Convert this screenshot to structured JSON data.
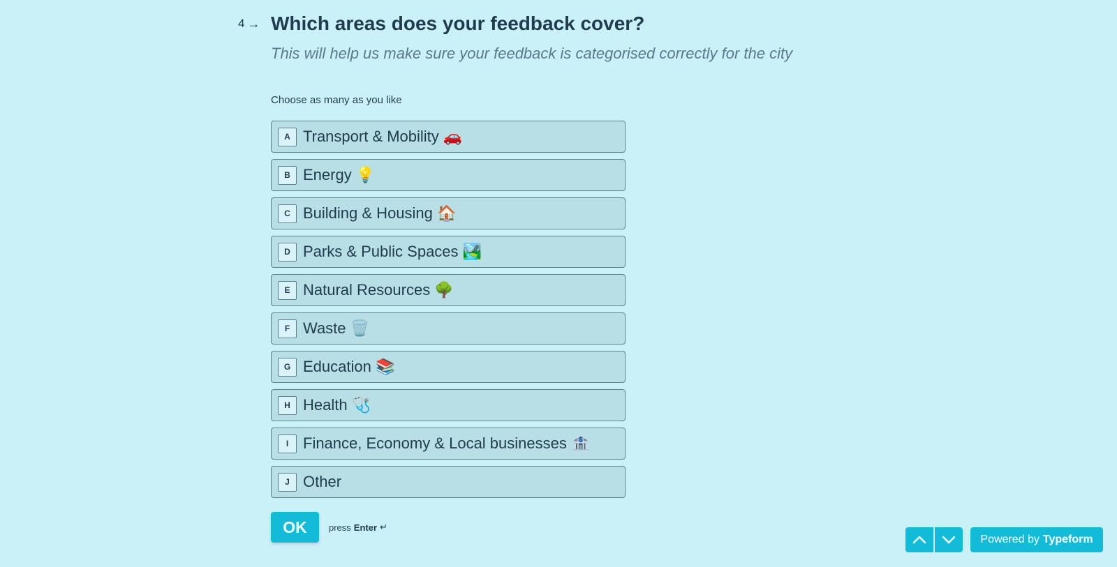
{
  "question": {
    "number": "4",
    "title": "Which areas does your feedback cover?",
    "subtitle": "This will help us make sure your feedback is categorised correctly for the city",
    "hint": "Choose as many as you like"
  },
  "options": [
    {
      "key": "A",
      "label": "Transport & Mobility 🚗"
    },
    {
      "key": "B",
      "label": "Energy 💡"
    },
    {
      "key": "C",
      "label": "Building & Housing 🏠"
    },
    {
      "key": "D",
      "label": "Parks & Public Spaces 🏞️"
    },
    {
      "key": "E",
      "label": "Natural Resources 🌳"
    },
    {
      "key": "F",
      "label": "Waste 🗑️"
    },
    {
      "key": "G",
      "label": "Education 📚"
    },
    {
      "key": "H",
      "label": "Health 🩺"
    },
    {
      "key": "I",
      "label": "Finance, Economy & Local businesses 🏦"
    },
    {
      "key": "J",
      "label": "Other"
    }
  ],
  "submit": {
    "ok_label": "OK",
    "press_label": "press",
    "enter_label": "Enter",
    "enter_symbol": "↵"
  },
  "footer": {
    "powered_prefix": "Powered by",
    "powered_brand": "Typeform"
  },
  "colors": {
    "background": "#cbf1f8",
    "accent": "#12bcd8",
    "text": "#1f3b4d",
    "option_bg": "#b9dfe6"
  }
}
